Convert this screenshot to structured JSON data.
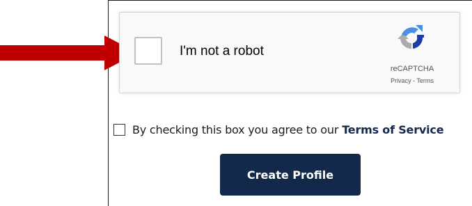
{
  "recaptcha": {
    "label": "I'm not a robot",
    "brand": "reCAPTCHA",
    "privacy_link": "Privacy",
    "separator": " - ",
    "terms_link": "Terms",
    "checked": false,
    "logo_icon": "recaptcha-logo-icon",
    "colors": {
      "logo_blue": "#4a90e2",
      "logo_dark_blue": "#1c3aa9",
      "logo_gray": "#ababab"
    }
  },
  "annotation": {
    "arrow_icon": "red-arrow-icon",
    "arrow_color": "#c00000"
  },
  "terms": {
    "checked": false,
    "text": "By checking this box you agree to our",
    "link": "Terms of Service"
  },
  "form": {
    "submit_label": "Create Profile",
    "accent_color": "#13294b"
  }
}
